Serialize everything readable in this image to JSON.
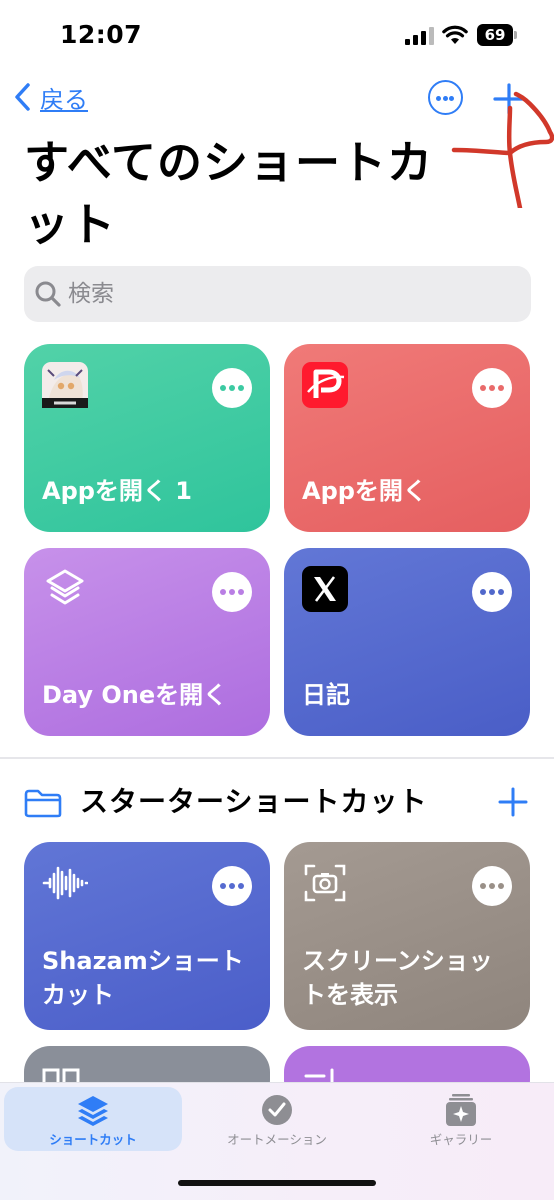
{
  "status_bar": {
    "time": "12:07",
    "battery": "69"
  },
  "nav": {
    "back_label": "戻る"
  },
  "page": {
    "title": "すべてのショートカット"
  },
  "search": {
    "placeholder": "検索"
  },
  "shortcuts": [
    {
      "label": "Appを開く 1",
      "color": "#3ccaa2",
      "icon": "hoyoverse-app-icon"
    },
    {
      "label": "Appを開く",
      "color": "#e96a6a",
      "icon": "paypay-app-icon"
    },
    {
      "label": "Day Oneを開く",
      "color": "#b97ee4",
      "icon": "layers-icon"
    },
    {
      "label": "日記",
      "color": "#5168cb",
      "icon": "x-app-icon"
    }
  ],
  "starter_section": {
    "title": "スターターショートカット",
    "shortcuts": [
      {
        "label": "Shazamショートカット",
        "color": "#566bd0",
        "icon": "waveform-icon"
      },
      {
        "label": "スクリーンショットを表示",
        "color": "#9a9088",
        "icon": "screenshot-camera-icon"
      }
    ]
  },
  "tab_bar": {
    "tabs": [
      {
        "label": "ショートカット",
        "active": true,
        "icon": "shortcuts-layers-icon"
      },
      {
        "label": "オートメーション",
        "active": false,
        "icon": "clock-check-icon"
      },
      {
        "label": "ギャラリー",
        "active": false,
        "icon": "gallery-sparkle-icon"
      }
    ]
  },
  "colors": {
    "accent": "#2f7df6",
    "annotation": "#d1382a"
  }
}
